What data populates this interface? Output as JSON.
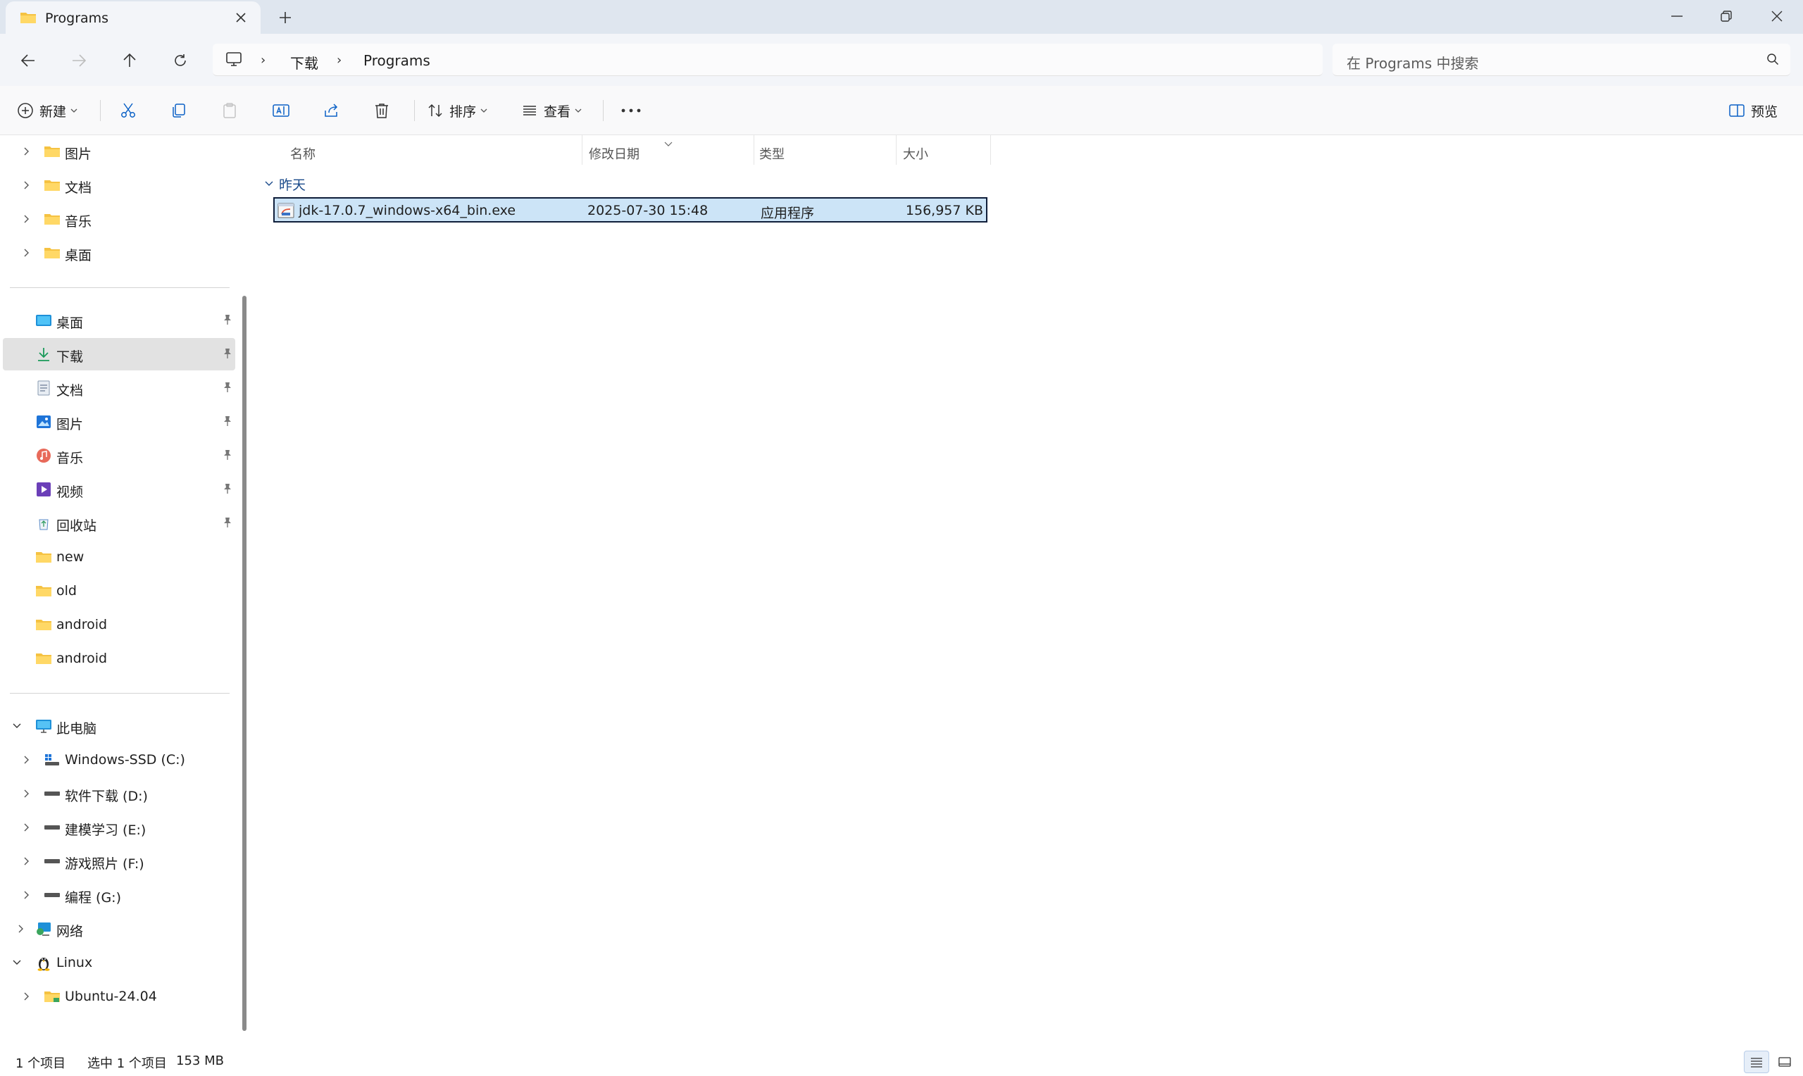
{
  "window": {
    "tab_title": "Programs",
    "new_tab_symbol": "+"
  },
  "address": {
    "crumbs": [
      "下载",
      "Programs"
    ],
    "search_placeholder": "在 Programs 中搜索"
  },
  "toolbar": {
    "new_label": "新建",
    "sort_label": "排序",
    "view_label": "查看",
    "more_symbol": "···",
    "preview_label": "预览"
  },
  "sidebar": {
    "top_items": [
      {
        "label": "图片"
      },
      {
        "label": "文档"
      },
      {
        "label": "音乐"
      },
      {
        "label": "桌面"
      }
    ],
    "quick_access": [
      {
        "label": "桌面",
        "icon": "desktop-icon"
      },
      {
        "label": "下载",
        "icon": "download-icon",
        "selected": true
      },
      {
        "label": "文档",
        "icon": "document-icon"
      },
      {
        "label": "图片",
        "icon": "pictures-icon"
      },
      {
        "label": "音乐",
        "icon": "music-icon"
      },
      {
        "label": "视频",
        "icon": "video-icon"
      },
      {
        "label": "回收站",
        "icon": "recycle-bin-icon"
      },
      {
        "label": "new",
        "icon": "folder-icon"
      },
      {
        "label": "old",
        "icon": "folder-icon"
      },
      {
        "label": "android",
        "icon": "folder-icon"
      },
      {
        "label": "android",
        "icon": "folder-icon"
      }
    ],
    "this_pc": {
      "label": "此电脑",
      "drives": [
        {
          "label": "Windows-SSD (C:)"
        },
        {
          "label": "软件下载 (D:)"
        },
        {
          "label": "建模学习 (E:)"
        },
        {
          "label": "游戏照片 (F:)"
        },
        {
          "label": "编程 (G:)"
        }
      ]
    },
    "network": {
      "label": "网络"
    },
    "linux": {
      "label": "Linux",
      "children": [
        {
          "label": "Ubuntu-24.04"
        }
      ]
    }
  },
  "content": {
    "columns": [
      "名称",
      "修改日期",
      "类型",
      "大小"
    ],
    "group_label": "昨天",
    "files": [
      {
        "name": "jdk-17.0.7_windows-x64_bin.exe",
        "modified": "2025-07-30 15:48",
        "type": "应用程序",
        "size": "156,957 KB"
      }
    ]
  },
  "status": {
    "item_count": "1 个项目",
    "selection": "选中 1 个项目",
    "selection_size": "153 MB"
  },
  "colors": {
    "accent": "#005fb8",
    "selection_bg": "#cce4f7",
    "folder": "#f5c242"
  }
}
